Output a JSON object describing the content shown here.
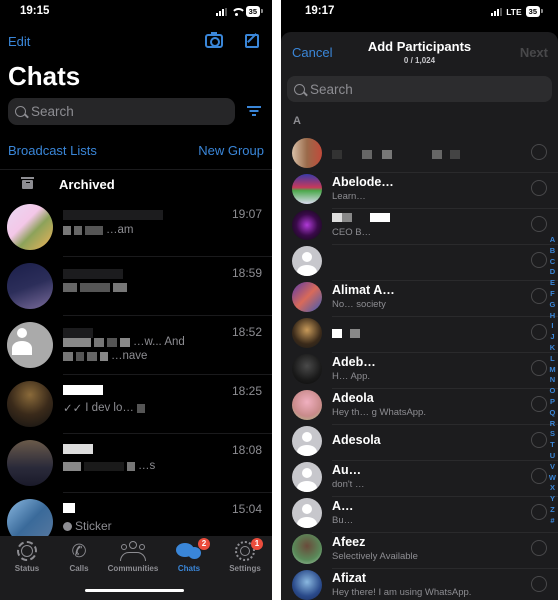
{
  "left_screen": {
    "status_bar": {
      "time": "19:15",
      "battery": "35"
    },
    "top_actions": {
      "edit": "Edit"
    },
    "title": "Chats",
    "search": {
      "placeholder": "Search"
    },
    "links": {
      "broadcast": "Broadcast Lists",
      "new_group": "New Group"
    },
    "archived": {
      "label": "Archived"
    },
    "chats": [
      {
        "time": "19:07",
        "preview": "…am"
      },
      {
        "time": "18:59",
        "preview": ""
      },
      {
        "time": "18:52",
        "preview": "…w... And",
        "preview2": "…nave"
      },
      {
        "time": "18:25",
        "preview": "I dev lo…"
      },
      {
        "time": "18:08",
        "preview": "…s"
      },
      {
        "time": "15:04",
        "preview": "Sticker"
      }
    ],
    "tab_bar": {
      "tabs": [
        {
          "label": "Status",
          "icon": "status-icon",
          "active": false
        },
        {
          "label": "Calls",
          "icon": "phone-icon",
          "active": false
        },
        {
          "label": "Communities",
          "icon": "communities-icon",
          "active": false
        },
        {
          "label": "Chats",
          "icon": "chats-icon",
          "active": true,
          "badge": "2"
        },
        {
          "label": "Settings",
          "icon": "gear-icon",
          "active": false,
          "badge": "1"
        }
      ]
    },
    "accent_color": "#3a86d8",
    "badge_color": "#eb4d3d"
  },
  "right_screen": {
    "status_bar": {
      "time": "19:17",
      "network": "LTE",
      "battery": "35"
    },
    "header": {
      "cancel": "Cancel",
      "title": "Add Participants",
      "subtitle": "0 / 1,024",
      "next": "Next"
    },
    "search": {
      "placeholder": "Search"
    },
    "section_letter": "A",
    "contacts": [
      {
        "name": "",
        "status": ""
      },
      {
        "name": "Abelode…",
        "status": "Learn…"
      },
      {
        "name": "",
        "status": "CEO B…"
      },
      {
        "name": "",
        "status": ""
      },
      {
        "name": "Alimat A…",
        "status": "No… society"
      },
      {
        "name": "",
        "status": ""
      },
      {
        "name": "Adeb…",
        "status": "H… App."
      },
      {
        "name": "Adeola",
        "status": "Hey th… g WhatsApp."
      },
      {
        "name": "Adesola",
        "status": ""
      },
      {
        "name": "Au…",
        "status": "don't …"
      },
      {
        "name": "A…",
        "status": "Bu…"
      },
      {
        "name": "Afeez",
        "status": "Selectively Available"
      },
      {
        "name": "Afizat",
        "status": "Hey there! I am using WhatsApp."
      }
    ],
    "alpha_index": [
      "A",
      "B",
      "C",
      "D",
      "E",
      "F",
      "G",
      "H",
      "I",
      "J",
      "K",
      "L",
      "M",
      "N",
      "O",
      "P",
      "Q",
      "R",
      "S",
      "T",
      "U",
      "V",
      "W",
      "X",
      "Y",
      "Z",
      "#"
    ]
  }
}
